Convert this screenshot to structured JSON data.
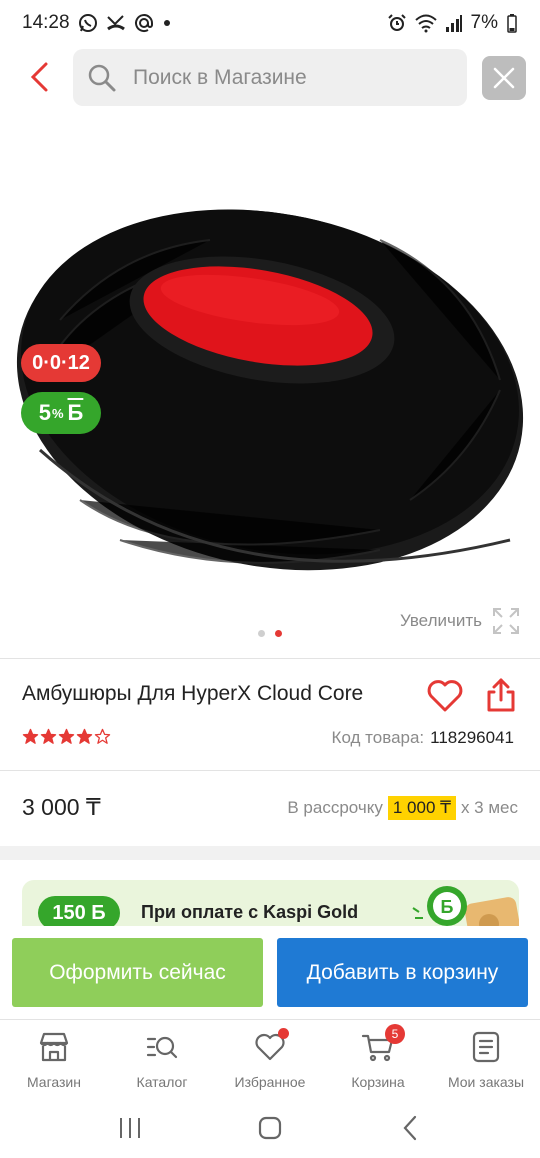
{
  "status_bar": {
    "time": "14:28",
    "battery": "7%",
    "icons": [
      "whatsapp-icon",
      "missed-call-icon",
      "at-icon",
      "dot-icon",
      "alarm-icon",
      "wifi-icon",
      "signal-icon",
      "battery-icon"
    ]
  },
  "search": {
    "placeholder": "Поиск в Магазине"
  },
  "product": {
    "installment_badge": "0·0·12",
    "bonus_badge_value": "5",
    "bonus_badge_unit": "%",
    "bonus_badge_currency": "Б",
    "zoom_label": "Увеличить",
    "images_total": 2,
    "image_active_index": 1,
    "title": "Амбушюры Для HyperX Cloud Core",
    "rating": 4,
    "rating_max": 5,
    "code_label": "Код товара:",
    "code_value": "118296041",
    "price": "3 000 ₸",
    "installment_prefix": "В рассрочку",
    "installment_amount": "1 000 ₸",
    "installment_suffix": "х 3 мес"
  },
  "gold_banner": {
    "bonus": "150 Б",
    "text": "При оплате с Kaspi Gold"
  },
  "actions": {
    "checkout_label": "Оформить сейчас",
    "add_to_cart_label": "Добавить в корзину"
  },
  "bottom_nav": {
    "items": [
      {
        "label": "Магазин",
        "icon": "store-icon"
      },
      {
        "label": "Каталог",
        "icon": "catalog-search-icon"
      },
      {
        "label": "Избранное",
        "icon": "heart-icon"
      },
      {
        "label": "Корзина",
        "icon": "cart-icon",
        "badge": "5"
      },
      {
        "label": "Мои заказы",
        "icon": "orders-icon"
      }
    ]
  },
  "colors": {
    "accent_red": "#e53935",
    "bonus_green": "#35a62b",
    "checkout_green": "#8fce5a",
    "cart_blue": "#1f7ad4",
    "installment_yellow": "#ffd200"
  }
}
